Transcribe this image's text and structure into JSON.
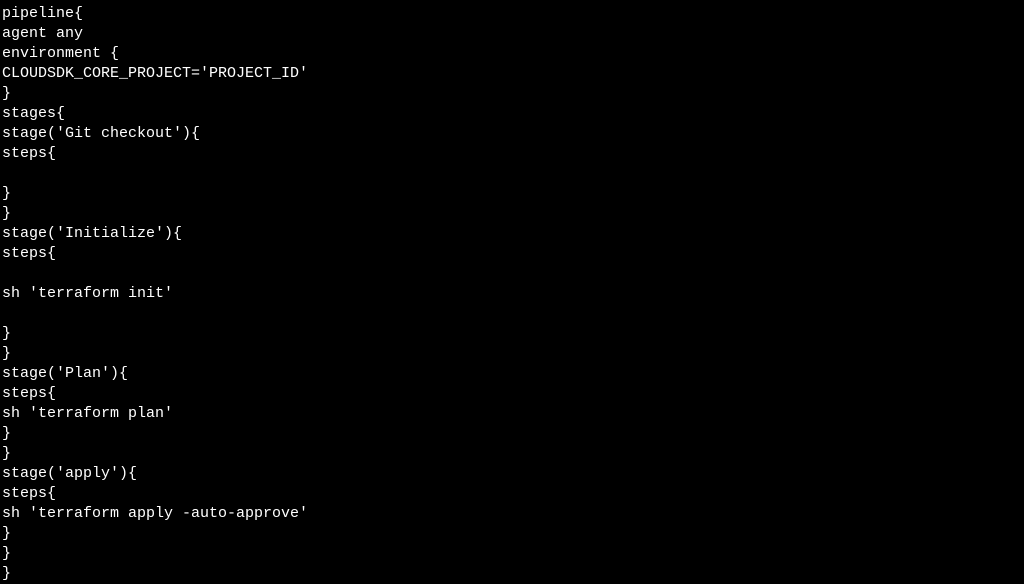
{
  "code_lines": [
    "pipeline{",
    "agent any",
    "environment {",
    "CLOUDSDK_CORE_PROJECT='PROJECT_ID'",
    "}",
    "stages{",
    "stage('Git checkout'){",
    "steps{",
    "",
    "}",
    "}",
    "stage('Initialize'){",
    "steps{",
    "",
    "sh 'terraform init'",
    "",
    "}",
    "}",
    "stage('Plan'){",
    "steps{",
    "sh 'terraform plan'",
    "}",
    "}",
    "stage('apply'){",
    "steps{",
    "sh 'terraform apply -auto-approve'",
    "}",
    "}",
    "}"
  ]
}
